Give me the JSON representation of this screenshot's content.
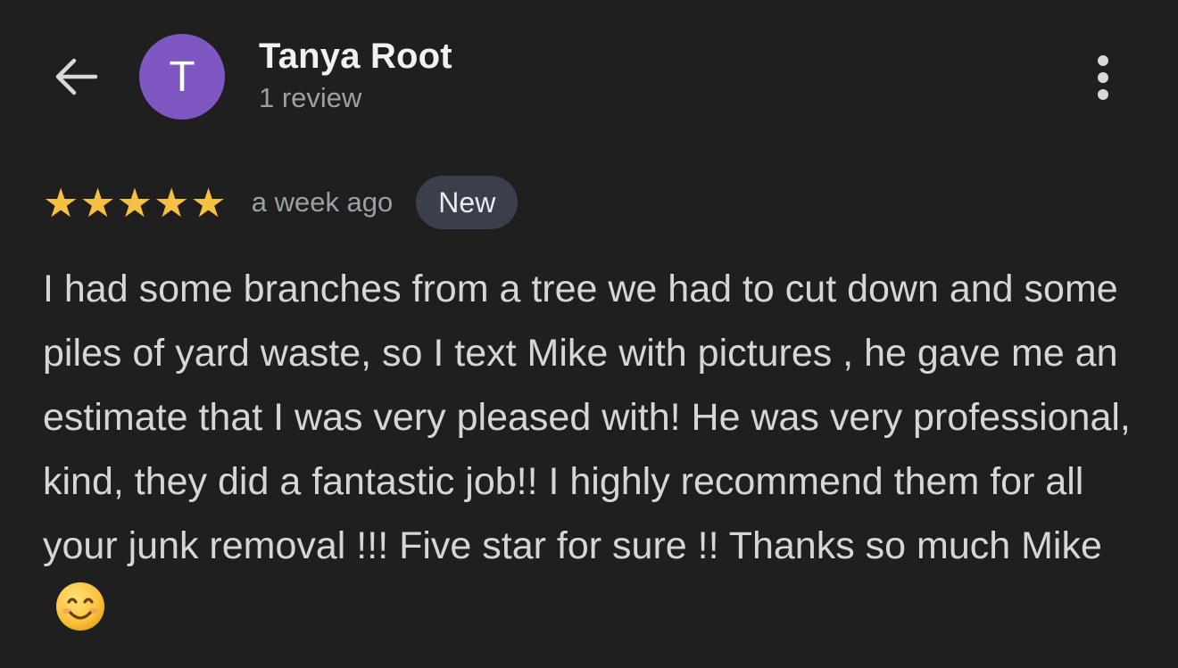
{
  "header": {
    "back_icon": "arrow-left-icon",
    "avatar_letter": "T",
    "avatar_color": "#7e57c2",
    "name": "Tanya Root",
    "review_count": "1 review",
    "more_icon": "more-vertical-icon"
  },
  "review": {
    "rating": 5,
    "max_rating": 5,
    "star_color": "#f6c044",
    "time": "a week ago",
    "badge": "New",
    "text": "I had some branches from a tree we had to cut down and some piles of yard waste, so I text Mike with pictures , he gave me an estimate that I was very pleased with! He was very professional, kind, they did a fantastic job!! I highly recommend them for all your junk removal !!! Five star for sure !! Thanks so much Mike",
    "emoji": "smiling-face-icon"
  },
  "colors": {
    "background": "#1f1f1f",
    "badge_background": "#3a3f4b"
  }
}
